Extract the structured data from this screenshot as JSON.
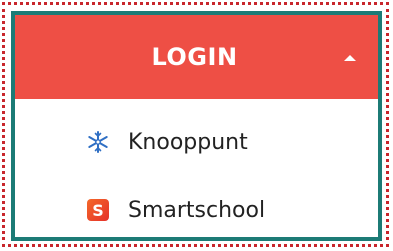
{
  "login_menu": {
    "title": "LOGIN",
    "expanded": true,
    "caret_icon": "caret-up-icon",
    "accent_color": "#ee4f45",
    "border_color": "#1c7b76",
    "items": [
      {
        "label": "Knooppunt",
        "icon": "knooppunt-logo-icon"
      },
      {
        "label": "Smartschool",
        "icon": "smartschool-logo-icon",
        "icon_letter": "S"
      }
    ]
  }
}
